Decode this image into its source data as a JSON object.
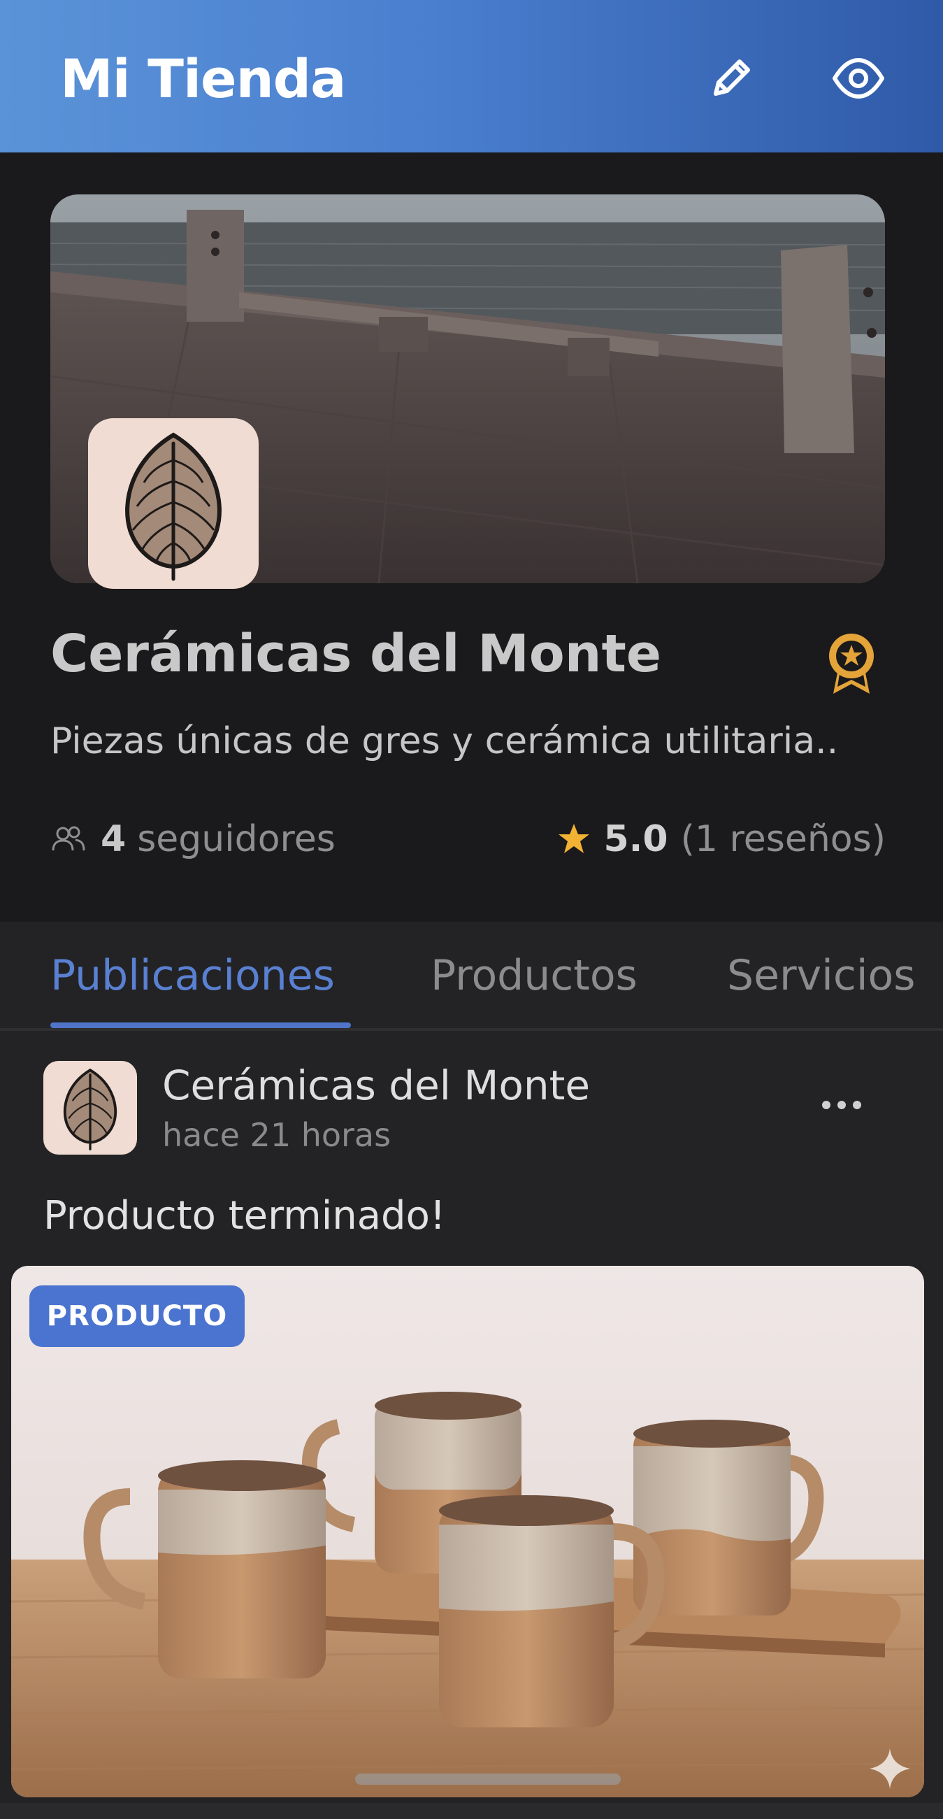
{
  "header": {
    "title": "Mi Tienda",
    "edit_icon": "pencil-icon",
    "view_icon": "eye-icon",
    "gradient": [
      "#5b93d8",
      "#2f5aa8"
    ]
  },
  "store": {
    "name": "Cerámicas del Monte",
    "description": "Piezas únicas de gres y cerámica utilitaria..",
    "followers_count": "4",
    "followers_label": "seguidores",
    "rating_value": "5.0",
    "rating_reviews": "(1 reseños)",
    "badge_icon": "award-badge-icon",
    "logo_icon": "leaf-logo-icon",
    "accent_badge_color": "#e4a43a"
  },
  "tabs": [
    {
      "label": "Publicaciones",
      "active": true
    },
    {
      "label": "Productos",
      "active": false
    },
    {
      "label": "Servicios",
      "active": false
    }
  ],
  "post": {
    "author": "Cerámicas del Monte",
    "time": "hace 21 horas",
    "text": "Producto terminado!",
    "badge": "PRODUCTO",
    "more_icon": "more-horizontal-icon"
  },
  "colors": {
    "accent": "#4a74cf",
    "background": "#1a191b",
    "star": "#f2b233"
  }
}
